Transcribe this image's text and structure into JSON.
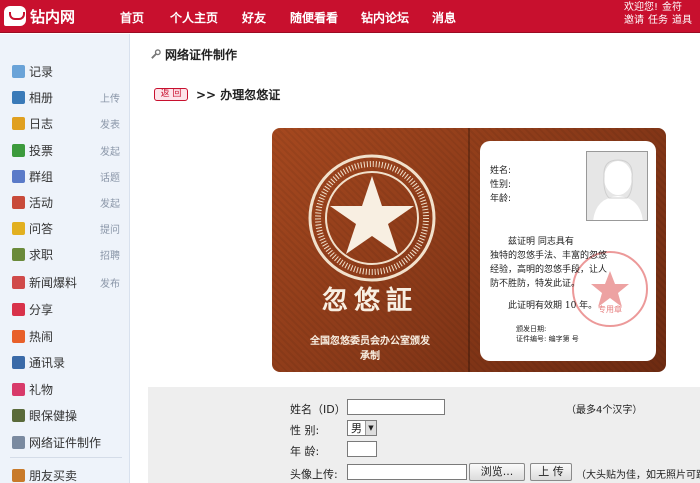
{
  "header": {
    "logo": "钻内网",
    "nav": [
      "首页",
      "个人主页",
      "好友",
      "随便看看",
      "钻内论坛",
      "消息"
    ],
    "top_right_line1": [
      "欢迎您!",
      "金符"
    ],
    "top_right_line2": [
      "邀请",
      "任务",
      "道具"
    ]
  },
  "sidebar": {
    "items": [
      {
        "label": "记录",
        "action": "",
        "icon": "chat-bubble-icon",
        "color": "#6aa3d8"
      },
      {
        "label": "相册",
        "action": "上传",
        "icon": "photo-album-icon",
        "color": "#3a7ab8"
      },
      {
        "label": "日志",
        "action": "发表",
        "icon": "journal-icon",
        "color": "#e0a020"
      },
      {
        "label": "投票",
        "action": "发起",
        "icon": "bar-chart-icon",
        "color": "#3c9a3c"
      },
      {
        "label": "群组",
        "action": "话题",
        "icon": "group-icon",
        "color": "#5a7ac8"
      },
      {
        "label": "活动",
        "action": "发起",
        "icon": "calendar-icon",
        "color": "#c84a3a"
      },
      {
        "label": "问答",
        "action": "提问",
        "icon": "question-icon",
        "color": "#e2b020"
      },
      {
        "label": "求职",
        "action": "招聘",
        "icon": "briefcase-icon",
        "color": "#6a8a3a"
      },
      {
        "label": "新闻爆料",
        "action": "发布",
        "icon": "megaphone-icon",
        "color": "#d04a4a"
      },
      {
        "label": "分享",
        "action": "",
        "icon": "heart-share-icon",
        "color": "#d8324a"
      },
      {
        "label": "热闹",
        "action": "",
        "icon": "fire-icon",
        "color": "#e8602a"
      },
      {
        "label": "通讯录",
        "action": "",
        "icon": "address-book-icon",
        "color": "#3a6aa8"
      },
      {
        "label": "礼物",
        "action": "",
        "icon": "gift-icon",
        "color": "#d83a6a"
      },
      {
        "label": "眼保健操",
        "action": "",
        "icon": "eye-icon",
        "color": "#5a6a3a"
      },
      {
        "label": "网络证件制作",
        "action": "",
        "icon": "wrench-icon",
        "color": "#7a8aa0"
      },
      {
        "label": "朋友买卖",
        "action": "",
        "icon": "trade-icon",
        "color": "#c87a2a"
      }
    ]
  },
  "page": {
    "title": "网络证件制作",
    "back_label": "返 回",
    "breadcrumb": ">> 办理忽悠证"
  },
  "certificate": {
    "title": "忽悠証",
    "issuer_line1": "全国忽悠委员会办公室颁发",
    "issuer_line2": "承制",
    "field_name": "姓名:",
    "field_gender": "性别:",
    "field_age": "年龄:",
    "body_line1": "兹证明          同志具有",
    "body_line2": "独特的忽悠手法、丰富的忽悠",
    "body_line3": "经验，高明的忽悠手段，让人",
    "body_line4": "防不胜防，特发此证。",
    "validity": "此证明有效期  10  年。",
    "issue_date": "颁发日期:",
    "cert_number": "证件编号: 编字第        号",
    "seal_text": "专用章",
    "seal_ring": "全国忽悠委员会办公室"
  },
  "form": {
    "name_label": "姓名（ID）",
    "name_value": "",
    "name_hint": "（最多4个汉字）",
    "gender_label": "性    别:",
    "gender_value": "男",
    "age_label": "年    龄:",
    "age_value": "",
    "avatar_label": "头像上传:",
    "avatar_value": "",
    "browse_label": "浏览...",
    "upload_label": "上 传",
    "avatar_hint": "（大头贴为佳，如无照片可跳"
  },
  "colors": {
    "brand_red": "#c8102e",
    "card_brown": "#8b3a1a",
    "sidebar_bg": "#eef3fa"
  }
}
